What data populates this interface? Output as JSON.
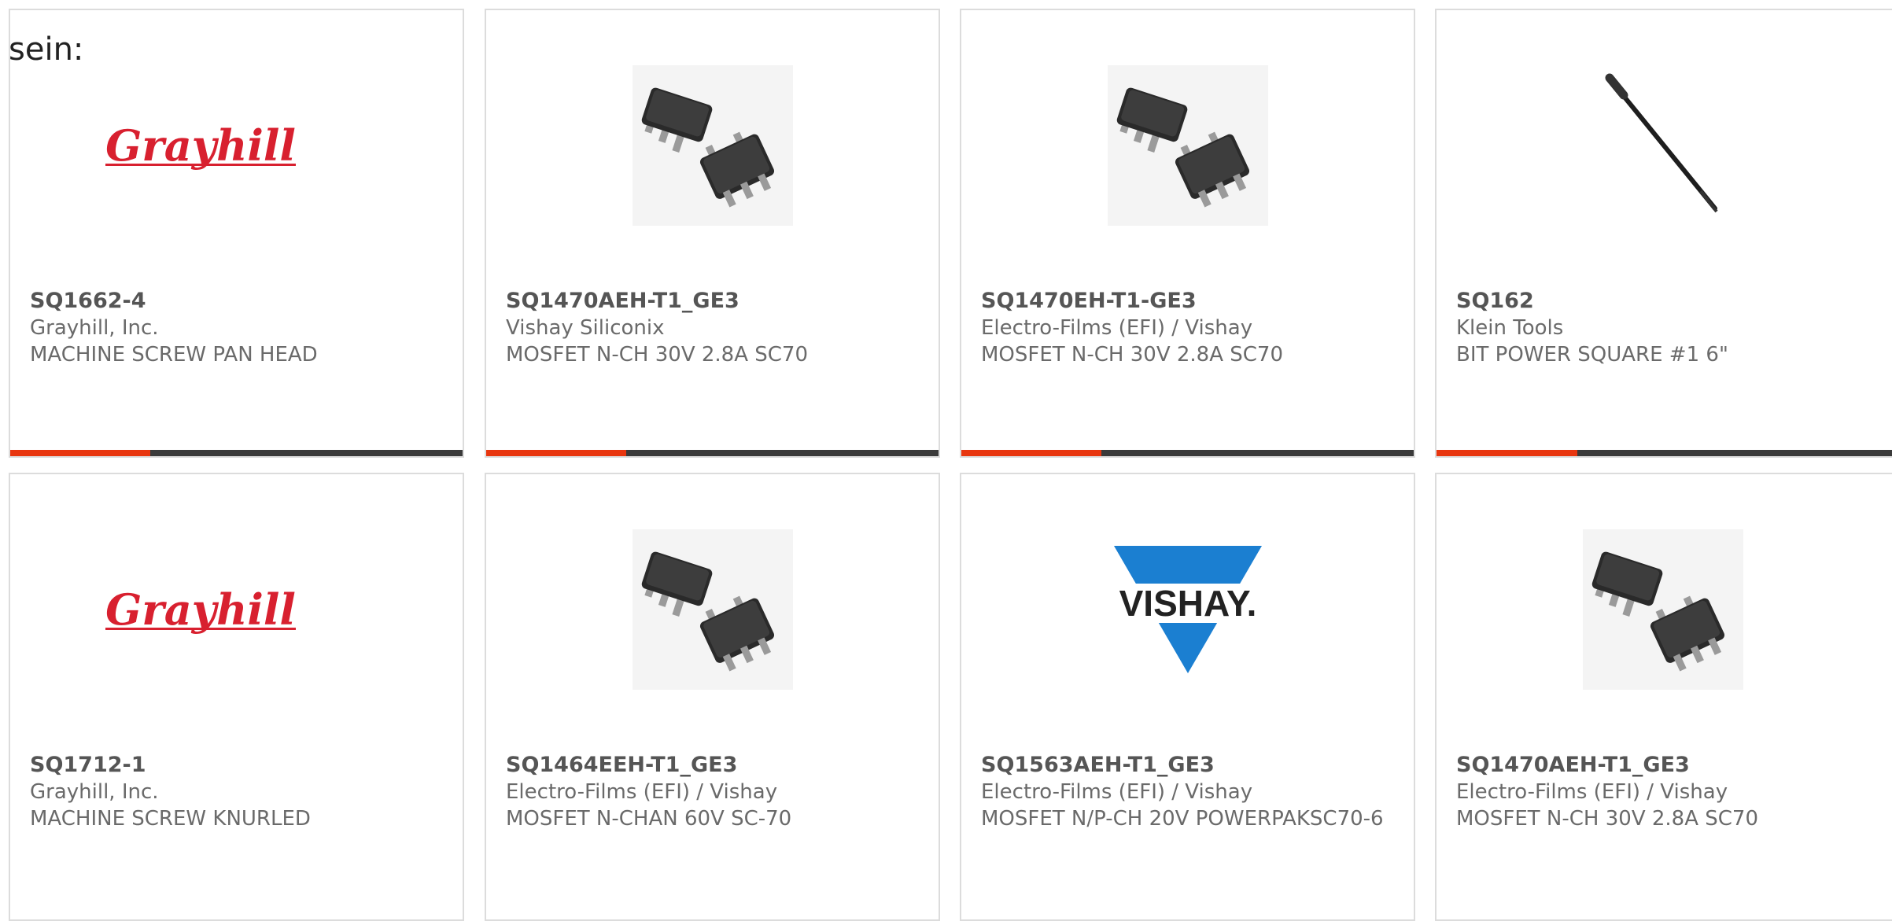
{
  "intro_text": "sein:",
  "accent_color": "#e8360f",
  "bar_track_color": "#3a3a3a",
  "products": [
    {
      "part": "SQ1662-4",
      "manufacturer": "Grayhill, Inc.",
      "description": "MACHINE SCREW PAN HEAD",
      "image": "grayhill-logo",
      "logo_text": "Grayhill",
      "progress": 0.31
    },
    {
      "part": "SQ1470AEH-T1_GE3",
      "manufacturer": "Vishay Siliconix",
      "description": "MOSFET N-CH 30V 2.8A SC70",
      "image": "sc70-package",
      "progress": 0.31
    },
    {
      "part": "SQ1470EH-T1-GE3",
      "manufacturer": "Electro-Films (EFI) / Vishay",
      "description": "MOSFET N-CH 30V 2.8A SC70",
      "image": "sc70-package",
      "progress": 0.31
    },
    {
      "part": "SQ162",
      "manufacturer": "Klein Tools",
      "description": "BIT POWER SQUARE #1 6\"",
      "image": "power-bit",
      "progress": 0.31
    },
    {
      "part": "SQ1712-1",
      "manufacturer": "Grayhill, Inc.",
      "description": "MACHINE SCREW KNURLED",
      "image": "grayhill-logo",
      "logo_text": "Grayhill"
    },
    {
      "part": "SQ1464EEH-T1_GE3",
      "manufacturer": "Electro-Films (EFI) / Vishay",
      "description": "MOSFET N-CHAN 60V SC-70",
      "image": "sc70-package"
    },
    {
      "part": "SQ1563AEH-T1_GE3",
      "manufacturer": "Electro-Films (EFI) / Vishay",
      "description": "MOSFET N/P-CH 20V POWERPAKSC70-6",
      "image": "vishay-logo",
      "logo_text": "VISHAY."
    },
    {
      "part": "SQ1470AEH-T1_GE3",
      "manufacturer": "Electro-Films (EFI) / Vishay",
      "description": "MOSFET N-CH 30V 2.8A SC70",
      "image": "sc70-package"
    }
  ]
}
